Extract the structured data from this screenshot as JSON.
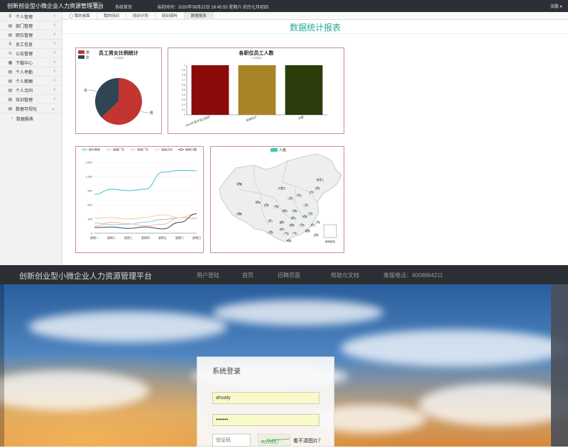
{
  "topbar": {
    "app_title": "创新创业型小微企业人力资源管理平台",
    "home_link": "系统首页",
    "clock": "当前时间：2020年08月22日 16:45:55 星期六   农历七月初四",
    "user": "张鹏 ▾"
  },
  "sidebar": {
    "items": [
      {
        "label": "个人管理",
        "icon": "user-icon",
        "glyph": "ꆜ"
      },
      {
        "label": "部门管理",
        "icon": "document-icon",
        "glyph": "▤"
      },
      {
        "label": "职位管理",
        "icon": "document-icon",
        "glyph": "▤"
      },
      {
        "label": "员工信息",
        "icon": "user-icon",
        "glyph": "ꆜ"
      },
      {
        "label": "公告管理",
        "icon": "refresh-icon",
        "glyph": "↻"
      },
      {
        "label": "下载中心",
        "icon": "grid-icon",
        "glyph": "▦"
      },
      {
        "label": "个人考勤",
        "icon": "document-icon",
        "glyph": "▤"
      },
      {
        "label": "个人薪酬",
        "icon": "document-icon",
        "glyph": "▤"
      },
      {
        "label": "个人合同",
        "icon": "document-icon",
        "glyph": "▤"
      },
      {
        "label": "培训管理",
        "icon": "document-icon",
        "glyph": "▤"
      },
      {
        "label": "数据可视化",
        "icon": "document-icon",
        "glyph": "▤"
      }
    ],
    "sub_item": "数据报表",
    "chevron": "‹",
    "chevron_open": "⌄",
    "sub_arrow": "›"
  },
  "tabs": [
    {
      "label": "◯ 我的桌面"
    },
    {
      "label": "我的培训"
    },
    {
      "label": "培训计划"
    },
    {
      "label": "培训资料"
    },
    {
      "label": "数据报表"
    }
  ],
  "page_title": "数据统计报表",
  "chart_data": [
    {
      "type": "pie",
      "title": "员工男女比例统计",
      "subtitle": "六同眼睛",
      "legend_position": "top-left",
      "categories": [
        "男",
        "女"
      ],
      "values": [
        63,
        37
      ],
      "colors": [
        "#c23531",
        "#2f4554"
      ]
    },
    {
      "type": "bar",
      "title": "各职位员工人数",
      "subtitle": "六同眼睛",
      "categories": [
        "Java开发开发工程师",
        "前端设计",
        "文案"
      ],
      "values": [
        1,
        1,
        1
      ],
      "colors": [
        "#8b0a0a",
        "#a98427",
        "#2a3d0a"
      ],
      "ylim": [
        0,
        1
      ],
      "yticks": [
        "0",
        "0.1",
        "0.2",
        "0.3",
        "0.4",
        "0.5",
        "0.6",
        "0.7",
        "0.8",
        "0.9",
        "1"
      ],
      "grid": false
    },
    {
      "type": "line",
      "legend_position": "top",
      "categories": [
        "星期一",
        "星期二",
        "星期三",
        "星期四",
        "星期五",
        "星期六",
        "星期日"
      ],
      "ylim": [
        0,
        1500
      ],
      "yticks": [
        "0",
        "300",
        "600",
        "900",
        "1,200",
        "1,500"
      ],
      "grid": true,
      "series": [
        {
          "name": "邮件营销",
          "color": "#3fc1c9",
          "values": [
            820,
            932,
            901,
            934,
            1290,
            1330,
            1320
          ]
        },
        {
          "name": "联盟广告",
          "color": "#a4c8e0",
          "values": [
            220,
            182,
            191,
            234,
            290,
            330,
            310
          ]
        },
        {
          "name": "视频广告",
          "color": "#f2b8a0",
          "values": [
            150,
            232,
            201,
            154,
            190,
            330,
            410
          ]
        },
        {
          "name": "直接访问",
          "color": "#f5d0a0",
          "values": [
            320,
            332,
            301,
            334,
            390,
            330,
            320
          ]
        },
        {
          "name": "搜索引擎",
          "color": "#34495e",
          "values": [
            120,
            132,
            101,
            134,
            90,
            230,
            410
          ]
        }
      ]
    },
    {
      "type": "map",
      "legend": "人数",
      "legend_color": "#3ec6b6",
      "regions": [
        "黑龙江",
        "吉林",
        "辽宁",
        "新疆",
        "内蒙古",
        "青海",
        "甘肃",
        "宁夏",
        "河北",
        "山西",
        "山东",
        "陕西",
        "河南",
        "江苏",
        "四川",
        "湖北",
        "安徽",
        "上海",
        "重庆",
        "湖南",
        "江西",
        "浙江",
        "西藏",
        "贵州",
        "福建",
        "云南",
        "广西",
        "广东",
        "台湾",
        "海南"
      ],
      "inset_label": "南海诸岛"
    }
  ],
  "footer_nav": {
    "brand": "创新创业型小微企业人力资源管理平台",
    "links": [
      "用户登陆",
      "首页",
      "招聘页面",
      "帮助与文档"
    ],
    "phone": "客服电话：4008864211"
  },
  "login": {
    "title": "系统登录",
    "username": "ahualy",
    "password": "•••••••",
    "captcha_placeholder": "验证码",
    "captcha_text": "nJ̶M̶U",
    "refresh_link": "看不清图片？"
  }
}
